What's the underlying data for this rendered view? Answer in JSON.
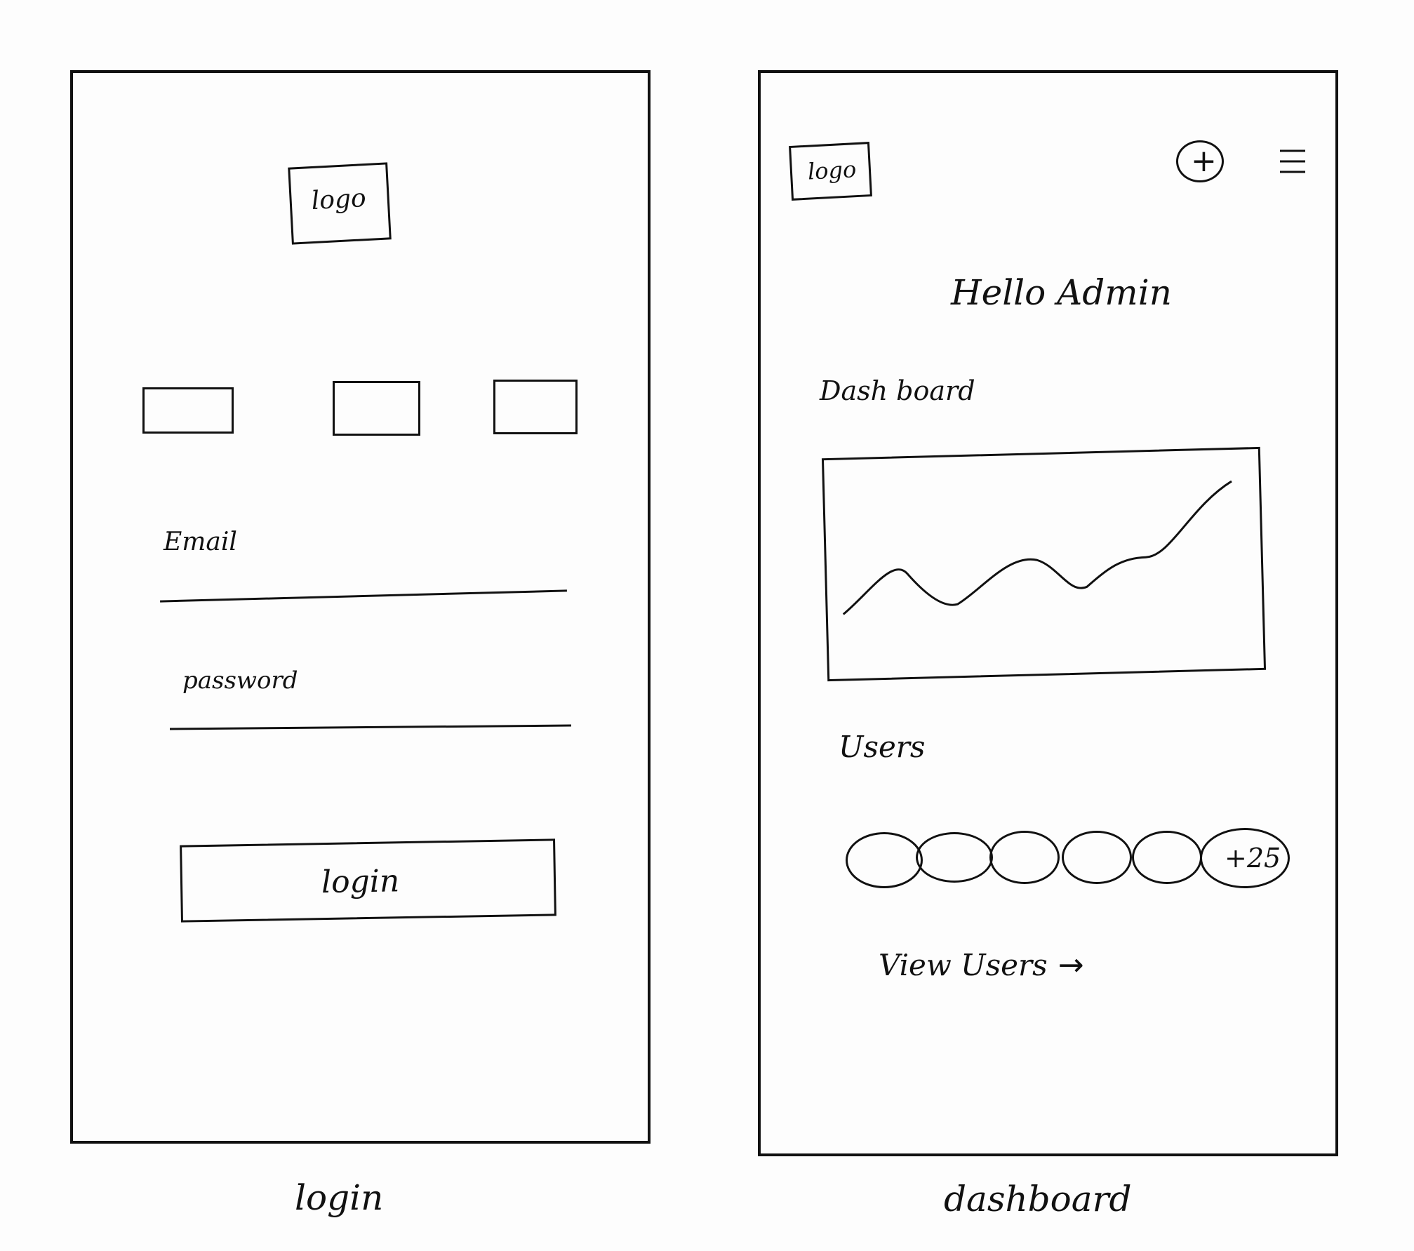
{
  "login": {
    "caption": "login",
    "logo_text": "logo",
    "email_label": "Email",
    "password_label": "password",
    "login_button": "login"
  },
  "dashboard": {
    "caption": "dashboard",
    "logo_text": "logo",
    "greeting": "Hello Admin",
    "section_dashboard": "Dash board",
    "section_users": "Users",
    "more_users": "+25",
    "view_users_link": "View Users"
  }
}
